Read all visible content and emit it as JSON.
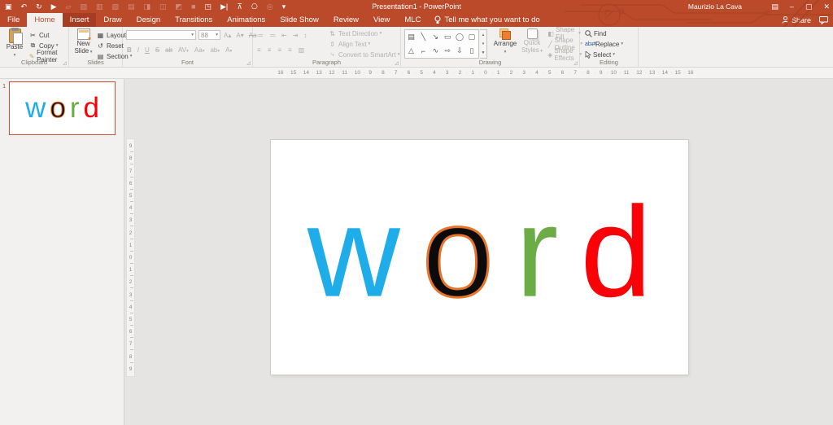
{
  "titlebar": {
    "title": "Presentation1 - PowerPoint",
    "user": "Maurizio La Cava",
    "qat": [
      {
        "g": "▣",
        "n": "save-icon",
        "dim": ""
      },
      {
        "g": "↶",
        "n": "undo-icon",
        "dim": ""
      },
      {
        "g": "↻",
        "n": "redo-icon",
        "dim": ""
      },
      {
        "g": "▶",
        "n": "start-from-beginning-icon",
        "dim": ""
      },
      {
        "g": "▱",
        "n": "addin-icon",
        "dim": "dim"
      },
      {
        "g": "▨",
        "n": "addin-icon",
        "dim": "dim"
      },
      {
        "g": "▥",
        "n": "addin-icon",
        "dim": "dim"
      },
      {
        "g": "▧",
        "n": "addin-icon",
        "dim": "dim"
      },
      {
        "g": "▤",
        "n": "addin-icon",
        "dim": "dim"
      },
      {
        "g": "◨",
        "n": "addin-icon",
        "dim": "dim"
      },
      {
        "g": "◫",
        "n": "addin-icon",
        "dim": "dim"
      },
      {
        "g": "◩",
        "n": "addin-icon",
        "dim": "dim"
      },
      {
        "g": "■",
        "n": "addin-icon",
        "dim": "dim"
      },
      {
        "g": "◳",
        "n": "fullscreen-icon",
        "dim": ""
      },
      {
        "g": "▶|",
        "n": "play-icon",
        "dim": ""
      },
      {
        "g": "⊼",
        "n": "fit-slide-icon",
        "dim": ""
      },
      {
        "g": "⎔",
        "n": "shape-addin-icon",
        "dim": ""
      },
      {
        "g": "◎",
        "n": "addin-icon",
        "dim": "dim"
      },
      {
        "g": "▾",
        "n": "qat-customize-icon",
        "dim": ""
      }
    ],
    "window": {
      "minimize": "–",
      "maximize": "▢",
      "close": "✕",
      "ribbon_options": "▤"
    }
  },
  "tabbar": {
    "tabs": [
      {
        "label": "File",
        "cls": "file"
      },
      {
        "label": "Home",
        "cls": "selected"
      },
      {
        "label": "Insert",
        "cls": "hover"
      },
      {
        "label": "Draw",
        "cls": ""
      },
      {
        "label": "Design",
        "cls": ""
      },
      {
        "label": "Transitions",
        "cls": ""
      },
      {
        "label": "Animations",
        "cls": ""
      },
      {
        "label": "Slide Show",
        "cls": ""
      },
      {
        "label": "Review",
        "cls": ""
      },
      {
        "label": "View",
        "cls": ""
      },
      {
        "label": "MLC",
        "cls": ""
      }
    ],
    "tellme": "Tell me what you want to do",
    "share": "Share"
  },
  "ribbon": {
    "clipboard": {
      "label": "Clipboard",
      "paste": "Paste",
      "cut": "Cut",
      "copy": "Copy",
      "format_painter": "Format Painter"
    },
    "slides": {
      "label": "Slides",
      "new_slide": "New Slide",
      "layout": "Layout",
      "reset": "Reset",
      "section": "Section"
    },
    "font": {
      "label": "Font",
      "size_value": "88",
      "font_name": "",
      "bold": "B",
      "italic": "I",
      "underline": "U",
      "strike": "S",
      "strike_icon": "ab",
      "spacing_icon": "AV",
      "case_icon": "Aa",
      "highlight_icon": "ab",
      "color_icon": "A",
      "grow": "A▴",
      "shrink": "A▾",
      "clear": "Aa"
    },
    "paragraph": {
      "label": "Paragraph",
      "row1_icons": [
        {
          "g": "≔",
          "n": "bullets-icon"
        },
        {
          "g": "≕",
          "n": "numbering-icon"
        },
        {
          "g": "⇤",
          "n": "decrease-indent-icon"
        },
        {
          "g": "⇥",
          "n": "increase-indent-icon"
        },
        {
          "g": "↕",
          "n": "line-spacing-icon"
        }
      ],
      "row2_icons": [
        {
          "g": "≡",
          "n": "align-left-icon"
        },
        {
          "g": "≡",
          "n": "align-center-icon"
        },
        {
          "g": "≡",
          "n": "align-right-icon"
        },
        {
          "g": "≡",
          "n": "justify-icon"
        },
        {
          "g": "▥",
          "n": "columns-icon"
        }
      ],
      "text_direction": "Text Direction",
      "align_text": "Align Text",
      "smartart": "Convert to SmartArt"
    },
    "drawing": {
      "label": "Drawing",
      "shapes": [
        "▤",
        "╲",
        "↘",
        "▭",
        "◯",
        "▢",
        "△",
        "⌐",
        "∿",
        "⇨",
        "⇩",
        "▯"
      ],
      "arrange": "Arrange",
      "quick_styles": "Quick Styles",
      "shape_fill": "Shape Fill",
      "shape_outline": "Shape Outline",
      "shape_effects": "Shape Effects"
    },
    "editing": {
      "label": "Editing",
      "find": "Find",
      "replace": "Replace",
      "select": "Select"
    }
  },
  "rulers": {
    "horizontal": [
      "16",
      "15",
      "14",
      "13",
      "12",
      "11",
      "10",
      "9",
      "8",
      "7",
      "6",
      "5",
      "4",
      "3",
      "2",
      "1",
      "0",
      "1",
      "2",
      "3",
      "4",
      "5",
      "6",
      "7",
      "8",
      "9",
      "10",
      "11",
      "12",
      "13",
      "14",
      "15",
      "16"
    ],
    "vertical": [
      "9",
      "8",
      "7",
      "6",
      "5",
      "4",
      "3",
      "2",
      "1",
      "0",
      "1",
      "2",
      "3",
      "4",
      "5",
      "6",
      "7",
      "8",
      "9"
    ]
  },
  "slide_panel": {
    "number": "1"
  },
  "slide": {
    "letters": [
      {
        "ch": "w",
        "color": "#1fadE9",
        "cls": "",
        "stroke": ""
      },
      {
        "ch": "o",
        "color": "#0b0b0b",
        "cls": "outlined",
        "stroke": "#e8732a"
      },
      {
        "ch": "r",
        "color": "#6cac47",
        "cls": "",
        "stroke": ""
      },
      {
        "ch": "d",
        "color": "#fb0007",
        "cls": "",
        "stroke": ""
      }
    ]
  },
  "colors": {
    "brand_red": "#bb4a2b",
    "tab_hover": "#a63d22",
    "ribbon_bg": "#f1f0ee",
    "canvas": "#e5e4e3",
    "selection_border": "#cc4f2e"
  }
}
